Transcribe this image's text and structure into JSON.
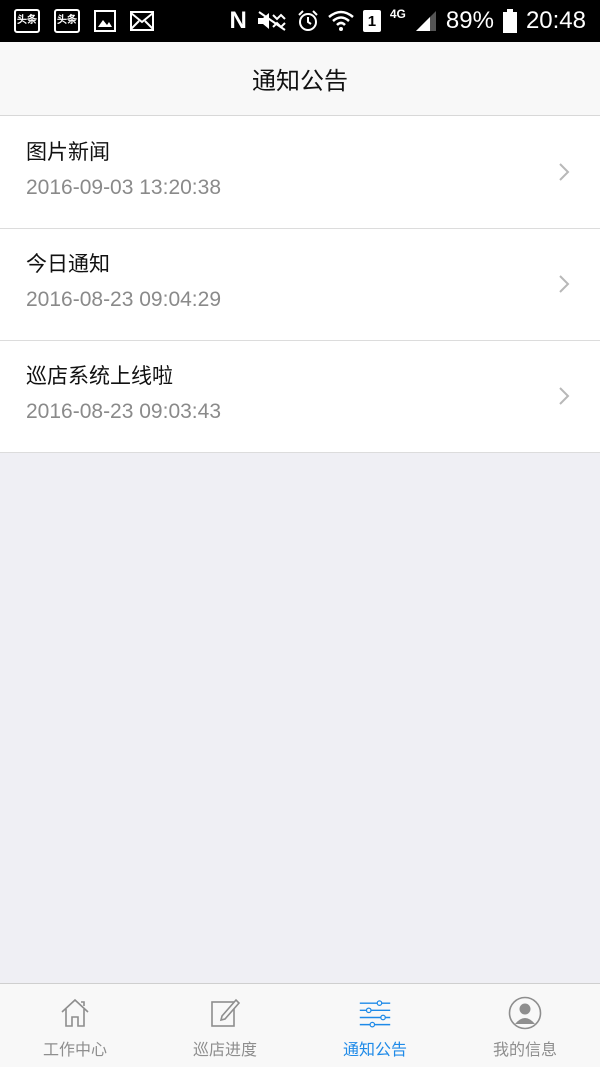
{
  "status_bar": {
    "app_icons": [
      "头条",
      "头条"
    ],
    "carrier_mark": "N",
    "sim": "1",
    "network": "4G",
    "battery": "89%",
    "time": "20:48"
  },
  "header": {
    "title": "通知公告"
  },
  "notices": [
    {
      "title": "图片新闻",
      "date": "2016-09-03 13:20:38"
    },
    {
      "title": "今日通知",
      "date": "2016-08-23 09:04:29"
    },
    {
      "title": "巡店系统上线啦",
      "date": "2016-08-23 09:03:43"
    }
  ],
  "tabs": [
    {
      "label": "工作中心",
      "icon": "home-icon"
    },
    {
      "label": "巡店进度",
      "icon": "edit-icon"
    },
    {
      "label": "通知公告",
      "icon": "sliders-icon"
    },
    {
      "label": "我的信息",
      "icon": "user-icon"
    }
  ],
  "colors": {
    "accent": "#1e8ae8",
    "tab_inactive": "#8e8e8e",
    "background": "#efeff4"
  }
}
